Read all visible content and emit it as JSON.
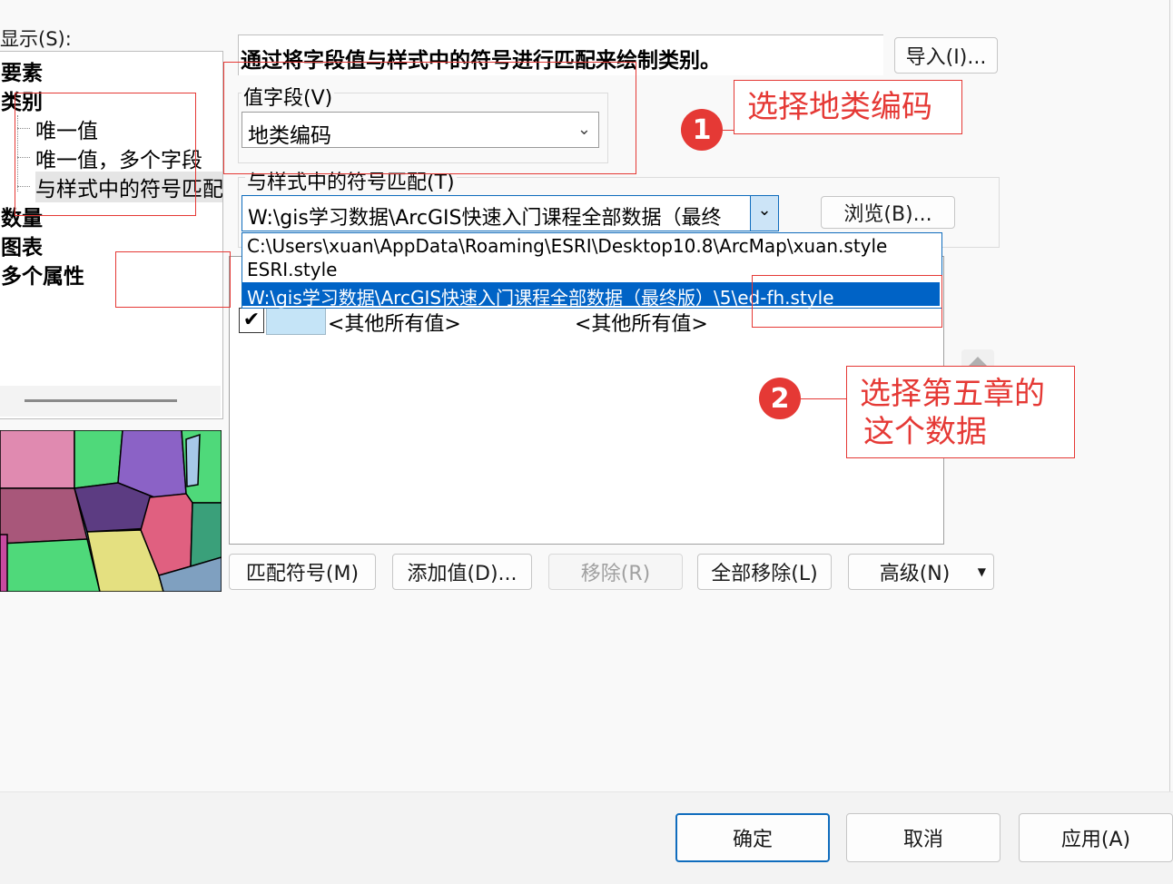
{
  "left_panel": {
    "show_label": "显示(S):",
    "tree": [
      {
        "label": "要素",
        "level": 0
      },
      {
        "label": "类别",
        "level": 0
      },
      {
        "label": "唯一值",
        "level": 1
      },
      {
        "label": "唯一值，多个字段",
        "level": 1
      },
      {
        "label": "与样式中的符号匹配",
        "level": 1
      },
      {
        "label": "数量",
        "level": 0
      },
      {
        "label": "图表",
        "level": 0
      },
      {
        "label": "多个属性",
        "level": 0
      }
    ]
  },
  "main": {
    "description": "通过将字段值与样式中的符号进行匹配来绘制类别。",
    "import_button": "导入(I)...",
    "value_field_label": "值字段(V)",
    "value_field_value": "地类编码",
    "match_style_label": "与样式中的符号匹配(T)",
    "style_path_value": "W:\\gis学习数据\\ArcGIS快速入门课程全部数据（最终",
    "browse_button": "浏览(B)...",
    "dropdown_options": [
      "C:\\Users\\xuan\\AppData\\Roaming\\ESRI\\Desktop10.8\\ArcMap\\xuan.style",
      "ESRI.style",
      "W:\\gis学习数据\\ArcGIS快速入门课程全部数据（最终版）\\5\\ed-fh.style"
    ],
    "selected_option_index": 2,
    "list_row": {
      "value": "<其他所有值>",
      "label": "<其他所有值>",
      "checked": true
    },
    "buttons": {
      "match": "匹配符号(M)",
      "add": "添加值(D)...",
      "remove": "移除(R)",
      "remove_all": "全部移除(L)",
      "advanced": "高级(N)"
    }
  },
  "footer": {
    "ok": "确定",
    "cancel": "取消",
    "apply": "应用(A)"
  },
  "annotations": {
    "step1_number": "1",
    "step1_text": "选择地类编码",
    "step2_number": "2",
    "step2_line1": "选择第五章的",
    "step2_line2": "这个数据",
    "color": "#e53935"
  }
}
